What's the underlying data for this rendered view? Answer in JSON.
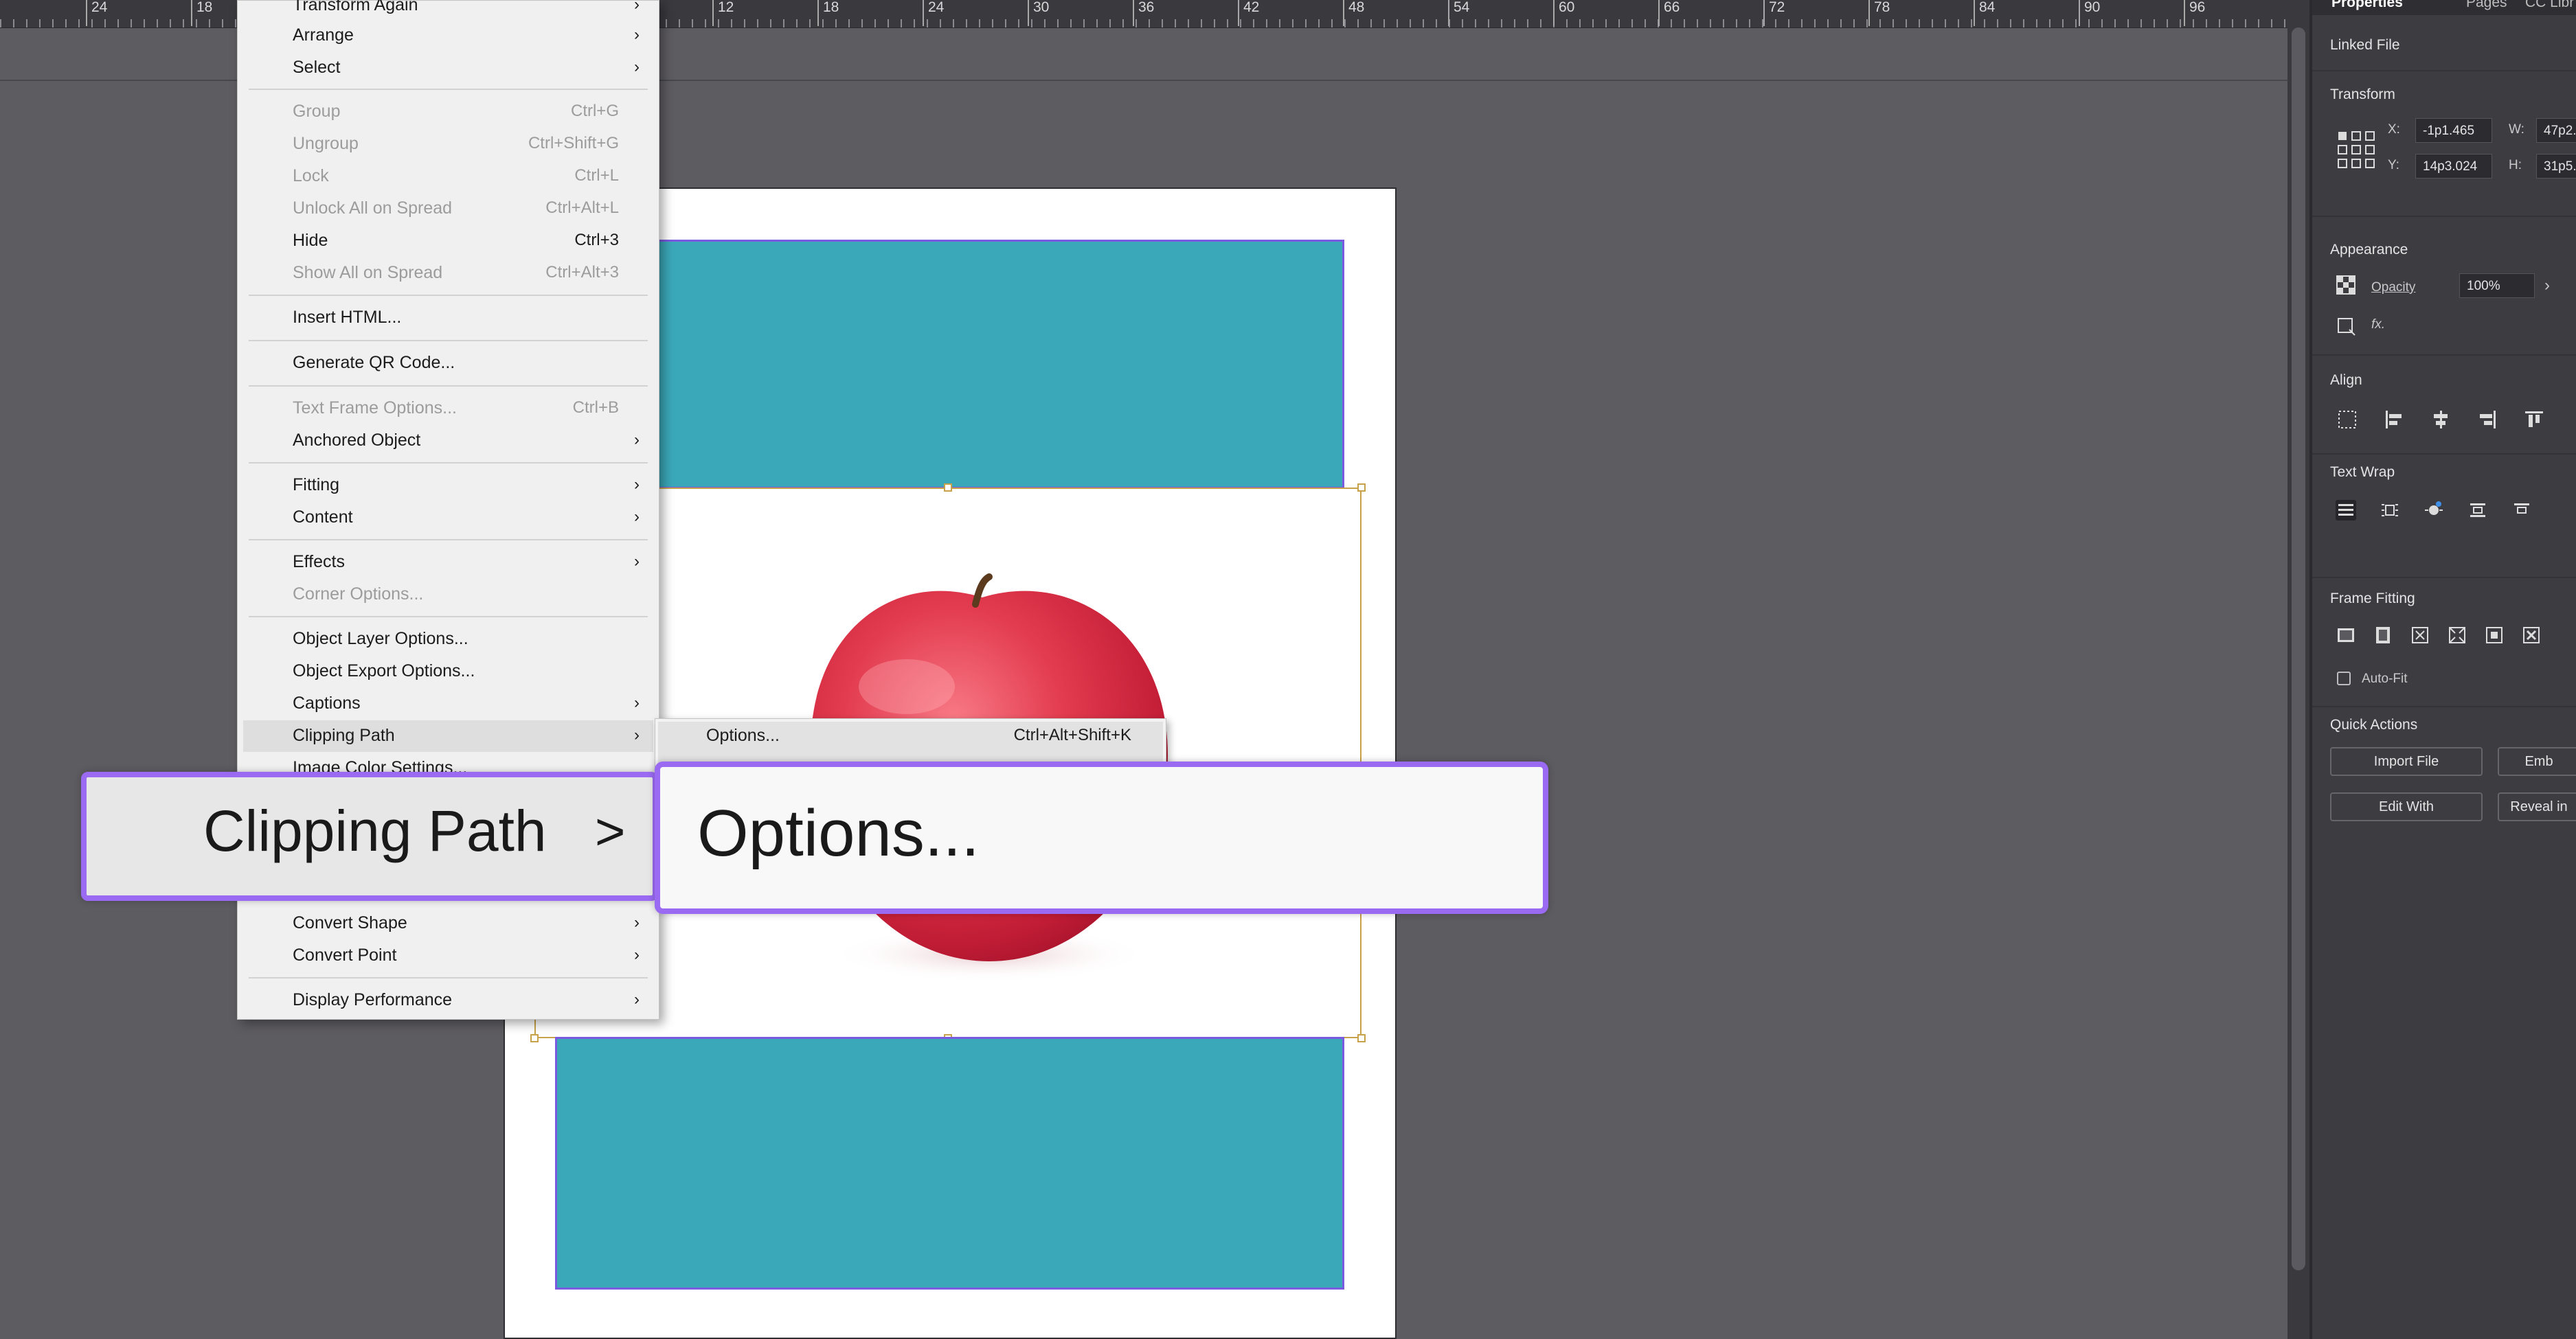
{
  "ruler": {
    "labels": [
      "24",
      "18",
      "12",
      "18",
      "24",
      "30",
      "36",
      "42",
      "48",
      "54",
      "60",
      "66",
      "72",
      "78",
      "84",
      "90",
      "96"
    ]
  },
  "menu": {
    "items": [
      {
        "label": "Transform Again",
        "enabled": true,
        "submenu": true
      },
      {
        "label": "Arrange",
        "enabled": true,
        "submenu": true
      },
      {
        "label": "Select",
        "enabled": true,
        "submenu": true
      },
      {
        "label": "Group",
        "shortcut": "Ctrl+G",
        "enabled": false
      },
      {
        "label": "Ungroup",
        "shortcut": "Ctrl+Shift+G",
        "enabled": false
      },
      {
        "label": "Lock",
        "shortcut": "Ctrl+L",
        "enabled": false
      },
      {
        "label": "Unlock All on Spread",
        "shortcut": "Ctrl+Alt+L",
        "enabled": false
      },
      {
        "label": "Hide",
        "shortcut": "Ctrl+3",
        "enabled": true
      },
      {
        "label": "Show All on Spread",
        "shortcut": "Ctrl+Alt+3",
        "enabled": false
      },
      {
        "label": "Insert HTML...",
        "enabled": true
      },
      {
        "label": "Generate QR Code...",
        "enabled": true
      },
      {
        "label": "Text Frame Options...",
        "shortcut": "Ctrl+B",
        "enabled": false
      },
      {
        "label": "Anchored Object",
        "enabled": true,
        "submenu": true
      },
      {
        "label": "Fitting",
        "enabled": true,
        "submenu": true
      },
      {
        "label": "Content",
        "enabled": true,
        "submenu": true
      },
      {
        "label": "Effects",
        "enabled": true,
        "submenu": true
      },
      {
        "label": "Corner Options...",
        "enabled": false
      },
      {
        "label": "Object Layer Options...",
        "enabled": true
      },
      {
        "label": "Object Export Options...",
        "enabled": true
      },
      {
        "label": "Captions",
        "enabled": true,
        "submenu": true
      },
      {
        "label": "Clipping Path",
        "enabled": true,
        "submenu": true,
        "highlighted": true
      },
      {
        "label": "Image Color Settings...",
        "enabled": true
      },
      {
        "label": "Convert Shape",
        "enabled": true,
        "submenu": true
      },
      {
        "label": "Convert Point",
        "enabled": true,
        "submenu": true
      },
      {
        "label": "Display Performance",
        "enabled": true,
        "submenu": true
      }
    ]
  },
  "submenu": {
    "option_label": "Options...",
    "option_shortcut": "Ctrl+Alt+Shift+K"
  },
  "zoom": {
    "left_label": "Clipping Path",
    "left_arrow": ">",
    "right_label": "Options..."
  },
  "panel": {
    "tabs": [
      "Properties",
      "Pages",
      "CC Libr"
    ],
    "linked_file": "Linked File",
    "transform": {
      "title": "Transform",
      "x_label": "X:",
      "x_value": "-1p1.465",
      "y_label": "Y:",
      "y_value": "14p3.024",
      "w_label": "W:",
      "w_value": "47p2.",
      "h_label": "H:",
      "h_value": "31p5."
    },
    "appearance": {
      "title": "Appearance",
      "opacity_label": "Opacity",
      "opacity_value": "100%",
      "fx_label": "fx."
    },
    "align_title": "Align",
    "text_wrap_title": "Text Wrap",
    "frame_fitting": {
      "title": "Frame Fitting",
      "auto_fit_label": "Auto-Fit"
    },
    "quick_actions": {
      "title": "Quick Actions",
      "import_file": "Import File",
      "embed": "Emb",
      "edit_with": "Edit With",
      "reveal": "Reveal in"
    }
  },
  "colors": {
    "accent": "#9a6af2",
    "teal": "#3ba8b9",
    "frame_bound": "#c8a24a"
  }
}
